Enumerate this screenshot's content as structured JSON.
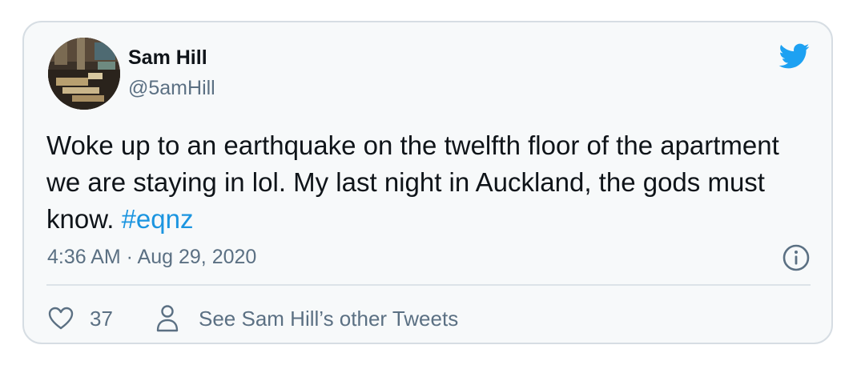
{
  "tweet": {
    "author_name": "Sam Hill",
    "author_handle": "@5amHill",
    "text": "Woke up to an earthquake on the twelfth floor of the apartment we are staying in lol. My last night in Auckland, the gods must know.",
    "hashtag": "#eqnz",
    "timestamp": "4:36 AM · Aug 29, 2020"
  },
  "actions": {
    "like_count": "37",
    "profile_link_label": "See Sam Hill’s other Tweets"
  },
  "icons": {
    "brand": "twitter-bird-icon",
    "info": "info-icon",
    "like": "heart-icon",
    "profile": "person-icon"
  },
  "colors": {
    "card_background": "#f7f9fa",
    "card_border": "#d6dde3",
    "primary_text": "#0f1419",
    "secondary_text": "#5b7083",
    "link": "#1b95e0",
    "twitter_blue": "#1da1f2"
  }
}
